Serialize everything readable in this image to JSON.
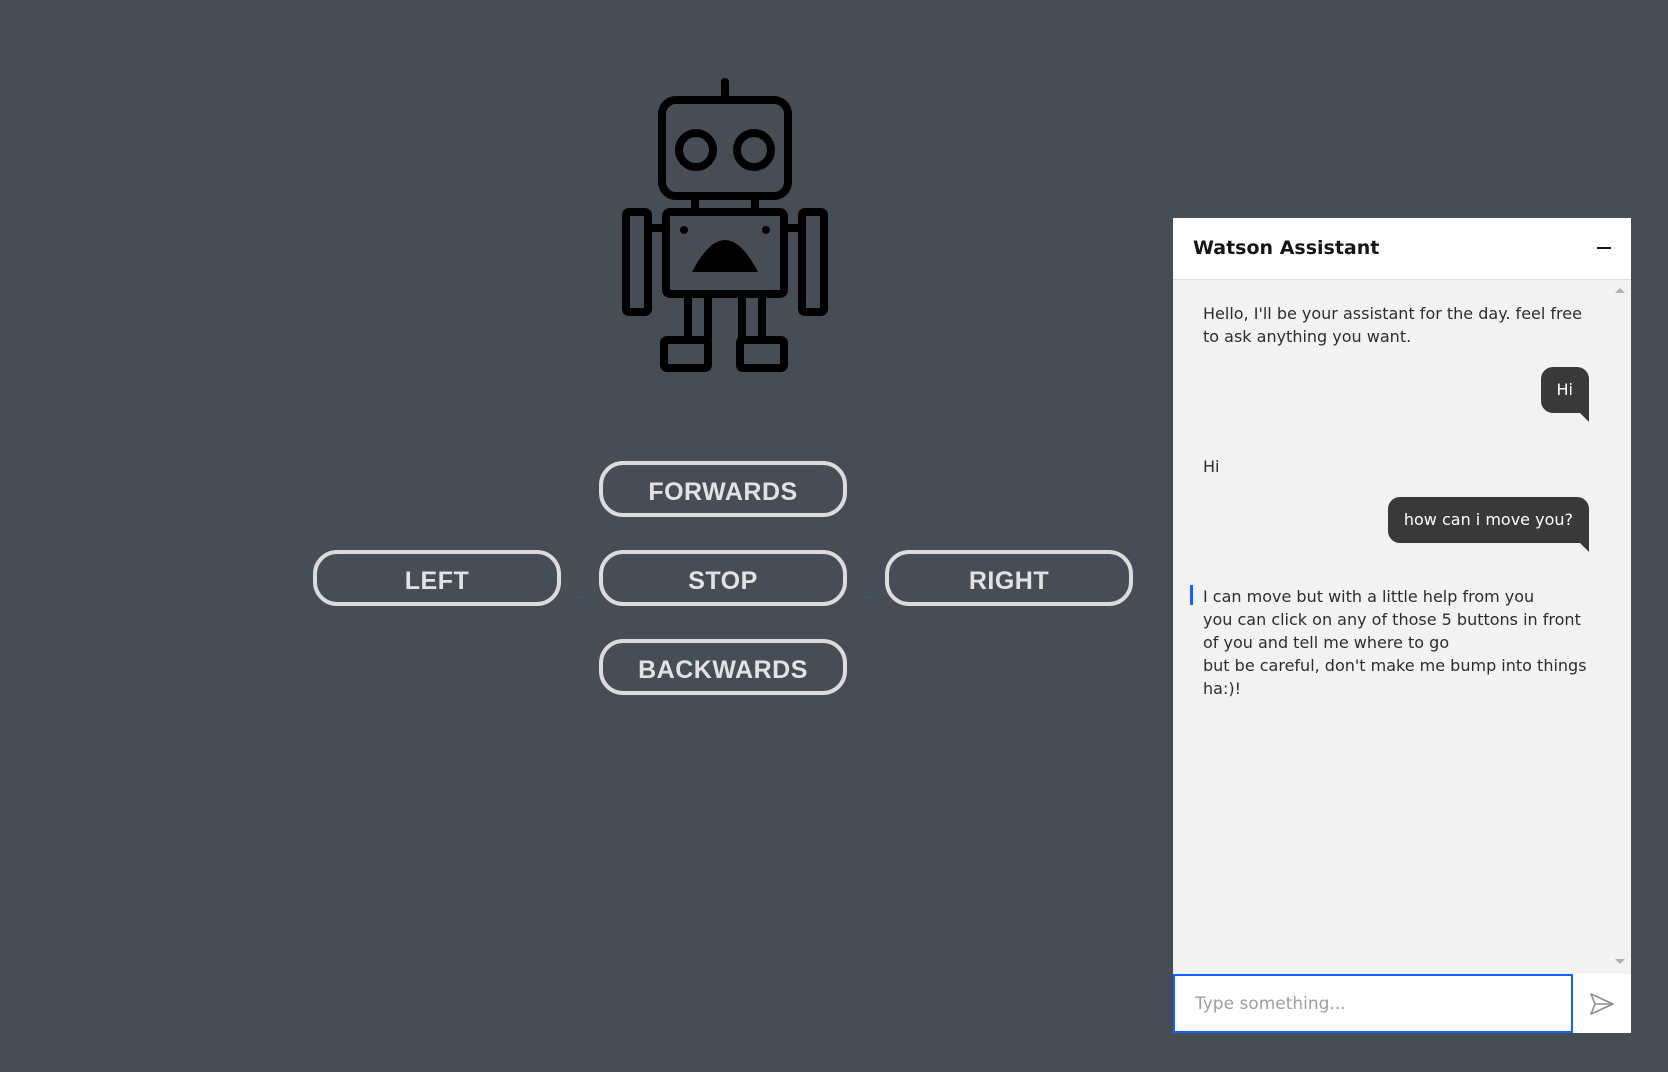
{
  "controls": {
    "forwards": "FORWARDS",
    "left": "LEFT",
    "stop": "STOP",
    "right": "RIGHT",
    "backwards": "BACKWARDS"
  },
  "robot": {
    "icon": "robot-icon"
  },
  "chat": {
    "title": "Watson Assistant",
    "messages": [
      {
        "from": "bot",
        "lines": [
          "Hello, I'll be your assistant for the day. feel free to ask anything you want."
        ]
      },
      {
        "from": "user",
        "text": "Hi"
      },
      {
        "from": "bot",
        "lines": [
          "Hi"
        ]
      },
      {
        "from": "user",
        "text": "how can i move you?"
      },
      {
        "from": "bot",
        "lines": [
          "I can move but with a little help from you",
          "you can click on any of those 5 buttons in front of you and tell me where to go",
          "but be careful, don't make me bump into things ha:)!"
        ]
      }
    ],
    "input_placeholder": "Type something..."
  },
  "colors": {
    "background": "#474d55",
    "button_border": "#dcdcdc",
    "user_bubble": "#393939",
    "accent": "#0f62fe"
  }
}
